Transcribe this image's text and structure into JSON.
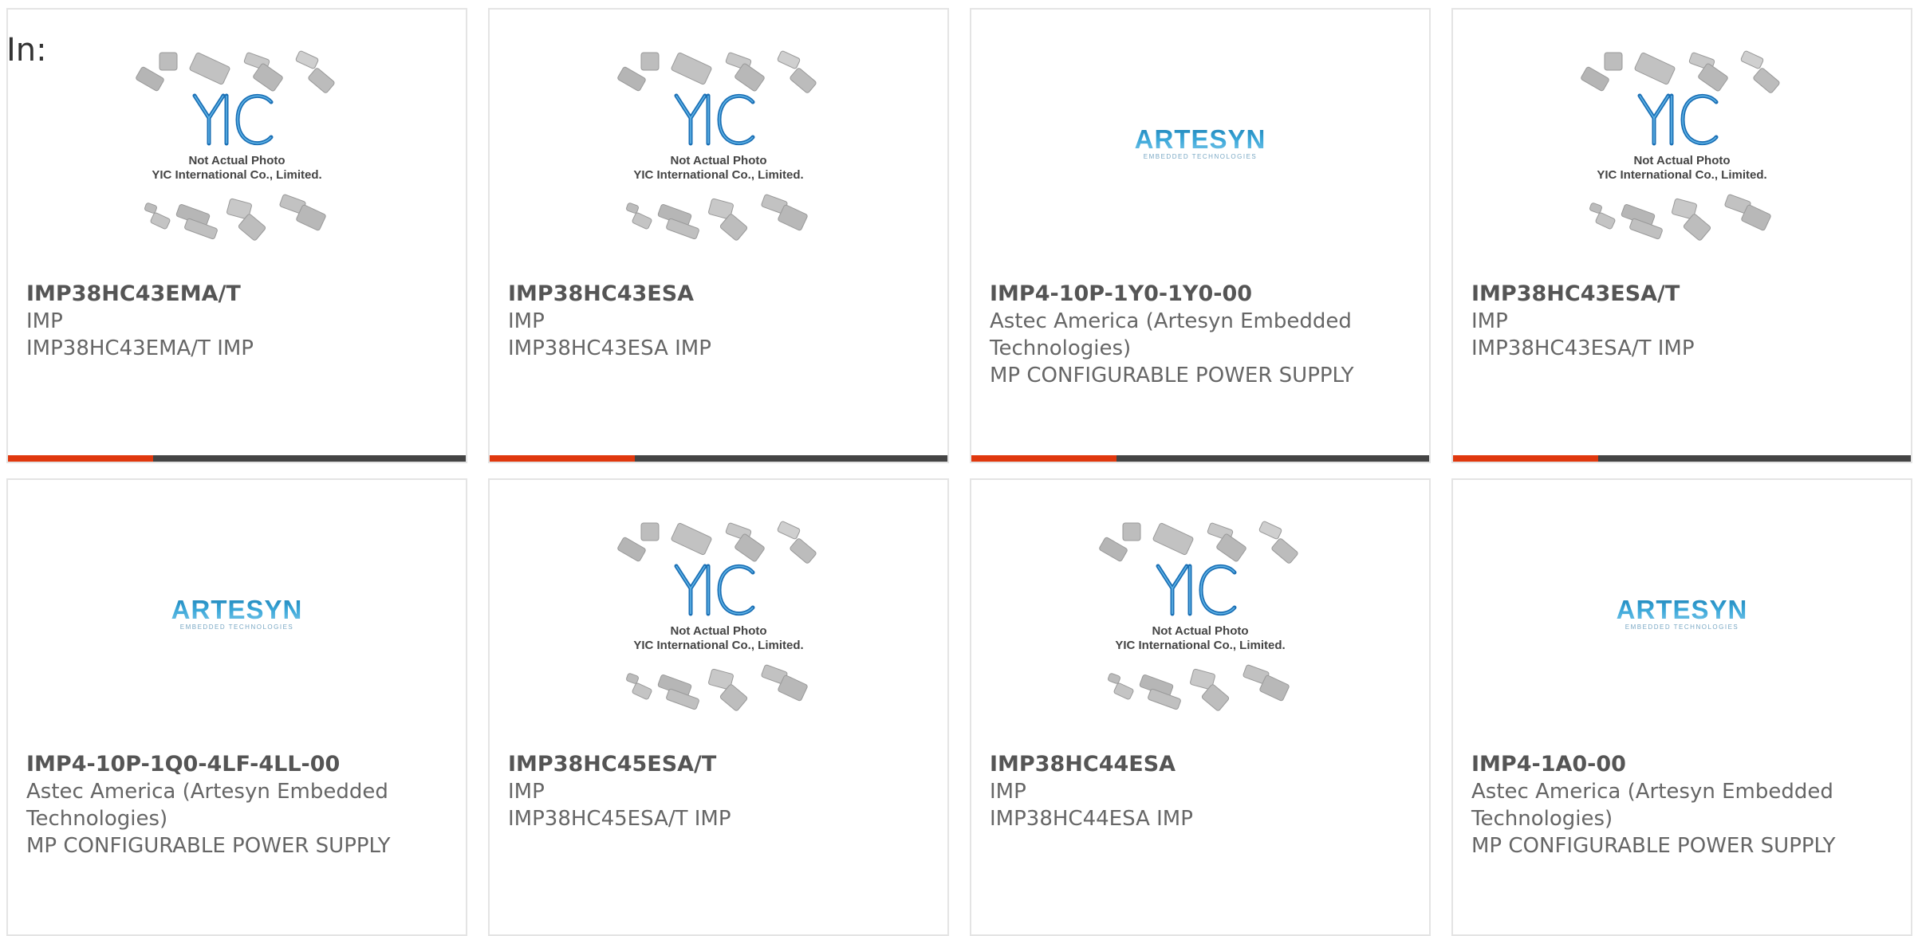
{
  "filter": {
    "label": "In:"
  },
  "colors": {
    "accent": "#e0380e",
    "bar": "#444444",
    "border": "#e4e4e4",
    "yic_blue": "#1a6fb5",
    "artesyn_blue": "#2a9bd0"
  },
  "products": [
    {
      "part": "IMP38HC43EMA/T",
      "maker": "IMP",
      "desc": "IMP38HC43EMA/T IMP",
      "image": "yic-placeholder"
    },
    {
      "part": "IMP38HC43ESA",
      "maker": "IMP",
      "desc": "IMP38HC43ESA IMP",
      "image": "yic-placeholder"
    },
    {
      "part": "IMP4-10P-1Y0-1Y0-00",
      "maker": "Astec America (Artesyn Embedded Technologies)",
      "desc": "MP CONFIGURABLE POWER SUPPLY",
      "image": "artesyn-logo"
    },
    {
      "part": "IMP38HC43ESA/T",
      "maker": "IMP",
      "desc": "IMP38HC43ESA/T IMP",
      "image": "yic-placeholder"
    },
    {
      "part": "IMP4-10P-1Q0-4LF-4LL-00",
      "maker": "Astec America (Artesyn Embedded Technologies)",
      "desc": "MP CONFIGURABLE POWER SUPPLY",
      "image": "artesyn-logo"
    },
    {
      "part": "IMP38HC45ESA/T",
      "maker": "IMP",
      "desc": "IMP38HC45ESA/T IMP",
      "image": "yic-placeholder"
    },
    {
      "part": "IMP38HC44ESA",
      "maker": "IMP",
      "desc": "IMP38HC44ESA IMP",
      "image": "yic-placeholder"
    },
    {
      "part": "IMP4-1A0-00",
      "maker": "Astec America (Artesyn Embedded Technologies)",
      "desc": "MP CONFIGURABLE POWER SUPPLY",
      "image": "artesyn-logo"
    }
  ],
  "placeholder": {
    "line1": "Not Actual Photo",
    "line2": "YIC International Co., Limited.",
    "logo": "YIC"
  },
  "artesyn": {
    "logo": "ARTESYN",
    "tagline": "EMBEDDED TECHNOLOGIES"
  }
}
